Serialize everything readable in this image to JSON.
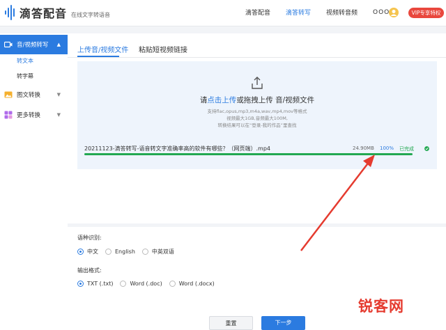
{
  "header": {
    "logo_name": "滴答配音",
    "logo_tag": "在线文字转语音",
    "nav": [
      "滴答配音",
      "滴答转写",
      "视频转音频"
    ],
    "user_dots": "OOO",
    "vip_label": "VIP专享特权"
  },
  "sidebar": {
    "items": [
      {
        "label": "音/视频转写"
      },
      {
        "label": "图文转换"
      },
      {
        "label": "更多转换"
      }
    ],
    "subs": [
      {
        "label": "转文本"
      },
      {
        "label": "转字幕"
      }
    ]
  },
  "tabs": [
    "上传音/视频文件",
    "粘贴短视频链接"
  ],
  "upload": {
    "title_prefix": "请",
    "title_link": "点击上传",
    "title_suffix": "或拖拽上传 音/视频文件",
    "hints": [
      "支持flac,opus,mp3,m4a,wav,mp4,mov等格式",
      "视频最大1GB,音频最大100M,",
      "转换结果可以在“登录-我的作品”里查找"
    ]
  },
  "file": {
    "name": "20211123-滴答转写-语音转文字准确率高的软件有哪些？（网页端）.mp4",
    "size": "24.90MB",
    "percent": "100%",
    "progress": 1.0,
    "status": "已完成"
  },
  "language": {
    "label": "语种识别:",
    "options": [
      "中文",
      "English",
      "中英双语"
    ],
    "selected": 0
  },
  "format": {
    "label": "输出格式:",
    "options": [
      "TXT (.txt)",
      "Word (.doc)",
      "Word (.docx)"
    ],
    "selected": 0
  },
  "buttons": {
    "reset": "重置",
    "next": "下一步"
  },
  "watermark": "锐客网",
  "colors": {
    "accent": "#2b7be0",
    "success": "#22a851",
    "vip": "#e9473d",
    "annotation": "#e53b2f"
  }
}
